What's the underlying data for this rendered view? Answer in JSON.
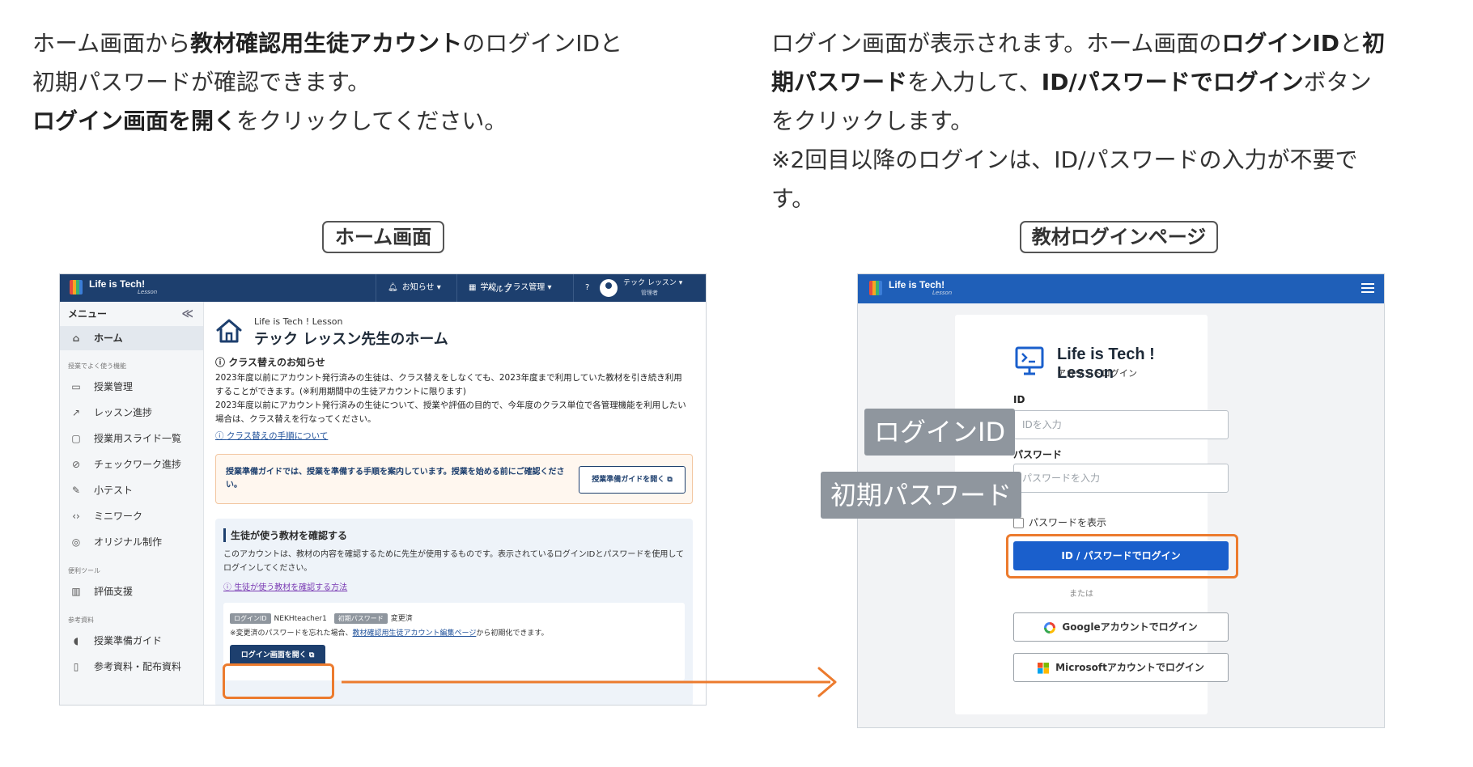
{
  "instructions": {
    "left": {
      "l1_a": "ホーム画面から",
      "l1_b": "教材確認用生徒アカウント",
      "l1_c": "のログインIDと",
      "l2": "初期パスワードが確認できます。",
      "l3_a": "ログイン画面を開く",
      "l3_b": "をクリックしてください。"
    },
    "right": {
      "l1_a": "ログイン画面が表示されます。ホーム画面の",
      "l1_b": "ログインID",
      "l1_c": "と",
      "l1_d": "初",
      "l2_a": "期パスワード",
      "l2_b": "を入力して、",
      "l2_c": "ID/パスワードでログイン",
      "l2_d": "ボタン",
      "l3": "をクリックします。",
      "l4": "※2回目以降のログインは、ID/パスワードの入力が不要で",
      "l5": "す。"
    }
  },
  "captions": {
    "home": "ホーム画面",
    "login": "教材ログインページ"
  },
  "home_screen": {
    "brand": "Life is Tech!",
    "brand_sub": "Lesson",
    "topbar": {
      "notice": "お知らせ",
      "school": "学校・クラス管理",
      "help": "ヘルプ",
      "user_name": "テック レッスン",
      "user_role": "管理者"
    },
    "sidebar": {
      "menu_label": "メニュー",
      "collapse": "≪",
      "home": "ホーム",
      "group1": "授業でよく使う機能",
      "items1": [
        "授業管理",
        "レッスン進捗",
        "授業用スライド一覧",
        "チェックワーク進捗",
        "小テスト",
        "ミニワーク",
        "オリジナル制作"
      ],
      "group2": "便利ツール",
      "items2": [
        "評価支援"
      ],
      "group3": "参考資料",
      "items3": [
        "授業準備ガイド",
        "参考資料・配布資料"
      ]
    },
    "main": {
      "breadcrumb": "Life is Tech ! Lesson",
      "title": "テック レッスン先生のホーム",
      "notice_title": "クラス替えのお知らせ",
      "notice_p1": "2023年度以前にアカウント発行済みの生徒は、クラス替えをしなくても、2023年度まで利用していた教材を引き続き利用することができます。(※利用期間中の生徒アカウントに限ります)",
      "notice_p2": "2023年度以前にアカウント発行済みの生徒について、授業や評価の目的で、今年度のクラス単位で各管理機能を利用したい場合は、クラス替えを行なってください。",
      "notice_link": "クラス替えの手順について",
      "guide_text": "授業準備ガイドでは、授業を準備する手順を案内しています。授業を始める前にご確認ください。",
      "guide_button": "授業準備ガイドを開く",
      "student_title": "生徒が使う教材を確認する",
      "student_body": "このアカウントは、教材の内容を確認するために先生が使用するものです。表示されているログインIDとパスワードを使用してログインしてください。",
      "student_link": "生徒が使う教材を確認する方法",
      "login_id_badge": "ログインID",
      "login_id_value": "NEKHteacher1",
      "pw_badge": "初期パスワード",
      "pw_value": "変更済",
      "note_a": "※変更済のパスワードを忘れた場合、",
      "note_link": "教材確認用生徒アカウント編集ページ",
      "note_b": "から初期化できます。",
      "open_login_button": "ログイン画面を開く"
    }
  },
  "login_screen": {
    "brand": "Life is Tech!",
    "brand_sub": "Lesson",
    "title": "Life is Tech ! Lesson",
    "subtitle": "アカウントログイン",
    "id_label": "ID",
    "id_placeholder": "IDを入力",
    "pw_label": "パスワード",
    "pw_placeholder": "パスワードを入力",
    "show_pw": "パスワードを表示",
    "submit": "ID / パスワードでログイン",
    "or": "または",
    "google": "Googleアカウントでログイン",
    "microsoft": "Microsoftアカウントでログイン"
  },
  "overlays": {
    "login_id": "ログインID",
    "initial_pw": "初期パスワード"
  },
  "colors": {
    "highlight": "#ec7b2e",
    "home_topbar": "#1d3f6e",
    "login_topbar": "#1f5fb8",
    "overlay": "#8f969e"
  }
}
